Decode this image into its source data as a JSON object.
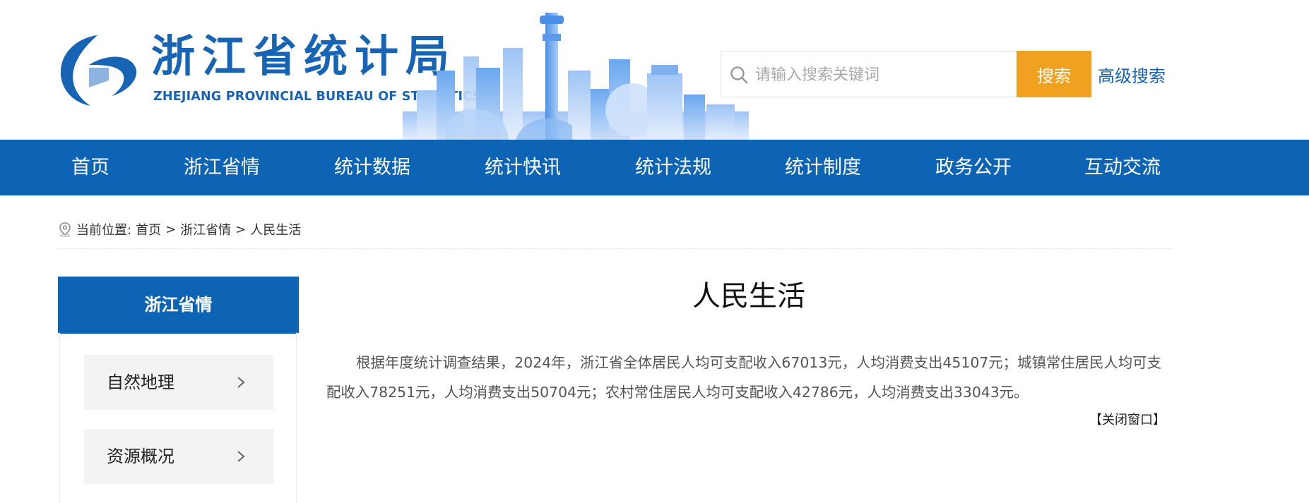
{
  "header": {
    "title": "浙江省统计局",
    "subtitle": "ZHEJIANG PROVINCIAL BUREAU OF STATISTICS",
    "search": {
      "placeholder": "请输入搜索关键词",
      "button": "搜索"
    },
    "advanced_search": "高级搜索",
    "colors": {
      "brand": "#1764b5",
      "search_button": "#efa11f"
    }
  },
  "nav": {
    "color": "#0d63b4",
    "items": [
      "首页",
      "浙江省情",
      "统计数据",
      "统计快讯",
      "统计法规",
      "统计制度",
      "政务公开",
      "互动交流"
    ]
  },
  "breadcrumb": {
    "prefix": "当前位置:",
    "items": [
      "首页",
      "浙江省情",
      "人民生活"
    ],
    "separator": ">"
  },
  "sidebar": {
    "title": "浙江省情",
    "items": [
      {
        "label": "自然地理",
        "icon": "chevron-right-icon"
      },
      {
        "label": "资源概况",
        "icon": "chevron-right-icon"
      }
    ]
  },
  "main": {
    "title": "人民生活",
    "body": "根据年度统计调查结果，2024年，浙江省全体居民人均可支配收入67013元，人均消费支出45107元；城镇常住居民人均可支配收入78251元，人均消费支出50704元；农村常住居民人均可支配收入42786元，人均消费支出33043元。",
    "close": "【关闭窗口】"
  }
}
